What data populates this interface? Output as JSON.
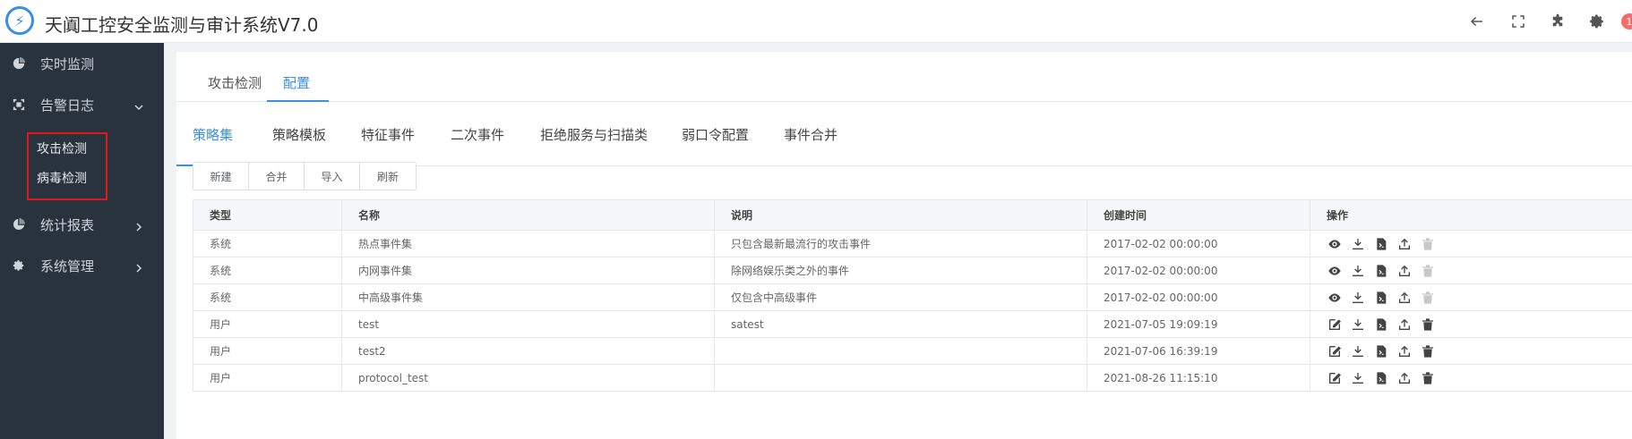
{
  "app": {
    "title": "天阗工控安全监测与审计系统V7.0",
    "logo_glyph": "⚡",
    "notification_count": "1",
    "badge_color": "#f56c6c",
    "accent": "#3a8ee6"
  },
  "sidebar": {
    "items": [
      {
        "label": "实时监测",
        "icon": "chart-pie-icon"
      },
      {
        "label": "告警日志",
        "icon": "alert-log-icon",
        "expanded": true
      },
      {
        "label": "统计报表",
        "icon": "report-icon"
      },
      {
        "label": "系统管理",
        "icon": "gear-icon"
      }
    ],
    "submenu": [
      "攻击检测",
      "病毒检测"
    ]
  },
  "tabs_top": {
    "items": [
      "攻击检测",
      "配置"
    ],
    "active": 1
  },
  "tabs_sub": {
    "items": [
      "策略集",
      "策略模板",
      "特征事件",
      "二次事件",
      "拒绝服务与扫描类",
      "弱口令配置",
      "事件合并"
    ],
    "active": 0
  },
  "toolbar": {
    "buttons": [
      "新建",
      "合并",
      "导入",
      "刷新"
    ]
  },
  "table": {
    "headers": [
      "类型",
      "名称",
      "说明",
      "创建时间",
      "操作"
    ],
    "rows": [
      {
        "type": "系统",
        "name": "热点事件集",
        "desc": "只包含最新最流行的攻击事件",
        "time": "2017-02-02 00:00:00",
        "ops": [
          "view-icon",
          "download-icon",
          "export-script-icon",
          "upload-icon",
          "delete-icon-disabled"
        ]
      },
      {
        "type": "系统",
        "name": "内网事件集",
        "desc": "除网络娱乐类之外的事件",
        "time": "2017-02-02 00:00:00",
        "ops": [
          "view-icon",
          "download-icon",
          "export-script-icon",
          "upload-icon",
          "delete-icon-disabled"
        ]
      },
      {
        "type": "系统",
        "name": "中高级事件集",
        "desc": "仅包含中高级事件",
        "time": "2017-02-02 00:00:00",
        "ops": [
          "view-icon",
          "download-icon",
          "export-script-icon",
          "upload-icon",
          "delete-icon-disabled"
        ]
      },
      {
        "type": "用户",
        "name": "test",
        "desc": "satest",
        "time": "2021-07-05 19:09:19",
        "ops": [
          "edit-icon",
          "download-icon",
          "export-script-icon",
          "upload-icon",
          "delete-icon"
        ]
      },
      {
        "type": "用户",
        "name": "test2",
        "desc": "",
        "time": "2021-07-06 16:39:19",
        "ops": [
          "edit-icon",
          "download-icon",
          "export-script-icon",
          "upload-icon",
          "delete-icon"
        ]
      },
      {
        "type": "用户",
        "name": "protocol_test",
        "desc": "",
        "time": "2021-08-26 11:15:10",
        "ops": [
          "edit-icon",
          "download-icon",
          "export-script-icon",
          "upload-icon",
          "delete-icon"
        ]
      }
    ]
  }
}
